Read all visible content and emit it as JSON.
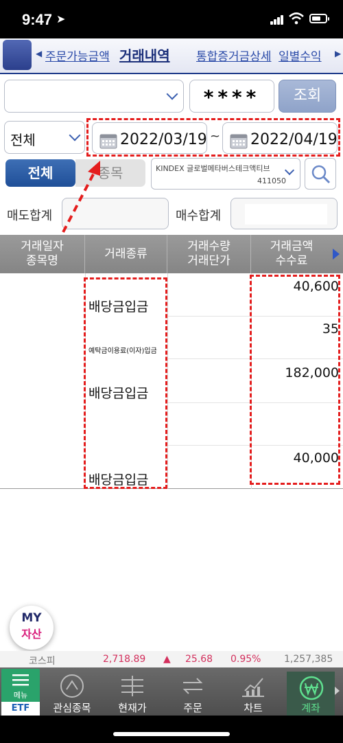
{
  "status": {
    "time": "9:47"
  },
  "tabs": [
    {
      "label": "주문가능금액",
      "active": false
    },
    {
      "label": "거래내역",
      "active": true
    },
    {
      "label": "통합증거금상세",
      "active": false
    },
    {
      "label": "일별수익",
      "active": false
    }
  ],
  "account": {
    "selected": "",
    "password_mask": "****",
    "query_button": "조회"
  },
  "filter": {
    "type": "전체",
    "date_from": "2022/03/19",
    "date_sep": "~",
    "date_to": "2022/04/19"
  },
  "segment": {
    "all_label": "전체",
    "item_label": "종목"
  },
  "product": {
    "name": "KINDEX 글로벌메타버스테크액티브",
    "code": "411050"
  },
  "totals": {
    "sell_label": "매도합계",
    "buy_label": "매수합계",
    "sell_value": "",
    "buy_value": ""
  },
  "table": {
    "headers": [
      {
        "line1": "거래일자",
        "line2": "종목명"
      },
      {
        "line1": "거래종류",
        "line2": ""
      },
      {
        "line1": "거래수량",
        "line2": "거래단가"
      },
      {
        "line1": "거래금액",
        "line2": "수수료"
      }
    ],
    "rows": [
      {
        "type": "배당금입금",
        "amount": "40,600"
      },
      {
        "type": "예탁금이용료(이자)입금",
        "amount": "35"
      },
      {
        "type": "배당금입금",
        "amount": "182,000"
      },
      {
        "type": "",
        "amount": ""
      },
      {
        "type": "배당금입금",
        "amount": "40,000"
      }
    ]
  },
  "my_asset": {
    "line1": "MY",
    "line2": "자산"
  },
  "ticker": {
    "name": "코스피",
    "index": "2,718.89",
    "arrow": "▲",
    "change": "25.68",
    "percent": "0.95%",
    "volume": "1,257,385"
  },
  "nav": {
    "menu_label": "메뉴",
    "menu_sub": "ETF",
    "items": [
      "관심종목",
      "현재가",
      "주문",
      "차트",
      "계좌"
    ]
  },
  "colors": {
    "brand": "#1d3a8a",
    "annotation": "#e41d1d",
    "up": "#d32f5c",
    "menu": "#2aa36b"
  }
}
